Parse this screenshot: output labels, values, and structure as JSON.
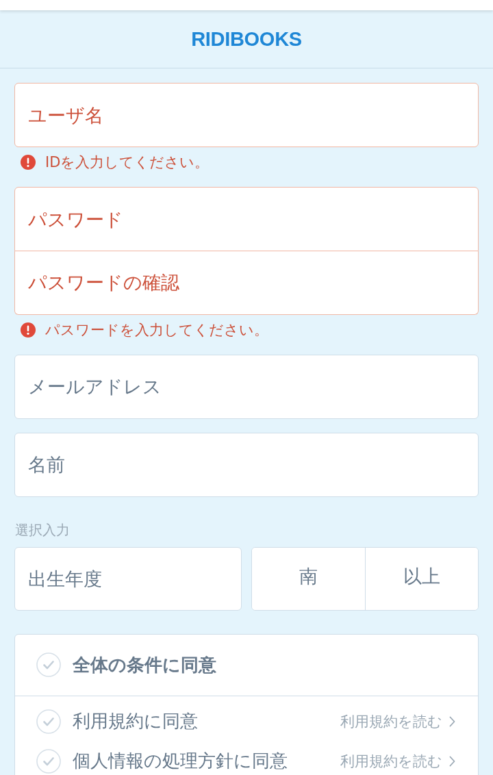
{
  "header": {
    "logo": "RIDIBOOKS"
  },
  "form_groups": [
    {
      "fields": [
        {
          "placeholder": "ユーザ名",
          "error": true
        }
      ],
      "error_message": "IDを入力してください。"
    },
    {
      "fields": [
        {
          "placeholder": "パスワード",
          "error": true
        },
        {
          "placeholder": "パスワードの確認",
          "error": true
        }
      ],
      "error_message": "パスワードを入力してください。"
    },
    {
      "fields": [
        {
          "placeholder": "メールアドレス",
          "error": false
        }
      ]
    },
    {
      "fields": [
        {
          "placeholder": "名前",
          "error": false
        }
      ]
    }
  ],
  "optional": {
    "label": "選択入力",
    "birth_year": {
      "placeholder": "出生年度",
      "error": false
    },
    "gender_options": [
      {
        "label": "南",
        "selected": false
      },
      {
        "label": "以上",
        "selected": false
      }
    ]
  },
  "agreements": {
    "all": {
      "label": "全体の条件に同意",
      "checked": false
    },
    "items": [
      {
        "label": "利用規約に同意",
        "checked": false,
        "link": "利用規約を読む"
      },
      {
        "label": "個人情報の処理方針に同意",
        "checked": false,
        "link": "利用規約を読む"
      }
    ]
  }
}
